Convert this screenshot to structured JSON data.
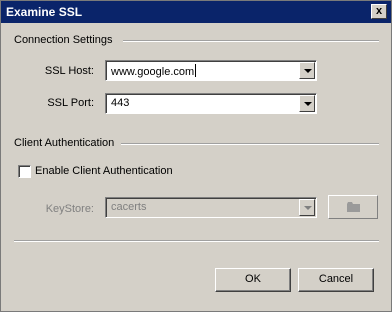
{
  "window": {
    "title": "Examine SSL",
    "close_label": "x"
  },
  "connection": {
    "group_title": "Connection Settings",
    "host_label": "SSL Host:",
    "host_value": "www.google.com",
    "port_label": "SSL Port:",
    "port_value": "443"
  },
  "client_auth": {
    "group_title": "Client Authentication",
    "enable_label": "Enable Client Authentication",
    "enable_checked": false,
    "keystore_label": "KeyStore:",
    "keystore_value": "cacerts",
    "browse_icon": "folder-icon"
  },
  "buttons": {
    "ok_label": "OK",
    "cancel_label": "Cancel"
  }
}
